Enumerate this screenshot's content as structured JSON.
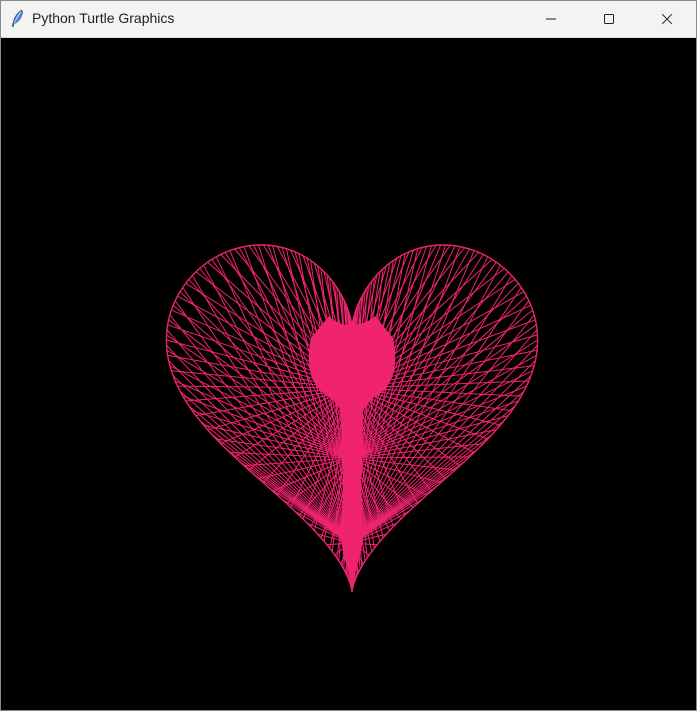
{
  "window": {
    "title": "Python Turtle Graphics",
    "icons": {
      "app": "feather-icon",
      "minimize": "minimize-icon",
      "maximize": "maximize-icon",
      "close": "close-icon"
    }
  },
  "canvas": {
    "background": "#000000",
    "drawing": {
      "shape": "heart",
      "stroke_color": "#f0246e"
    }
  }
}
